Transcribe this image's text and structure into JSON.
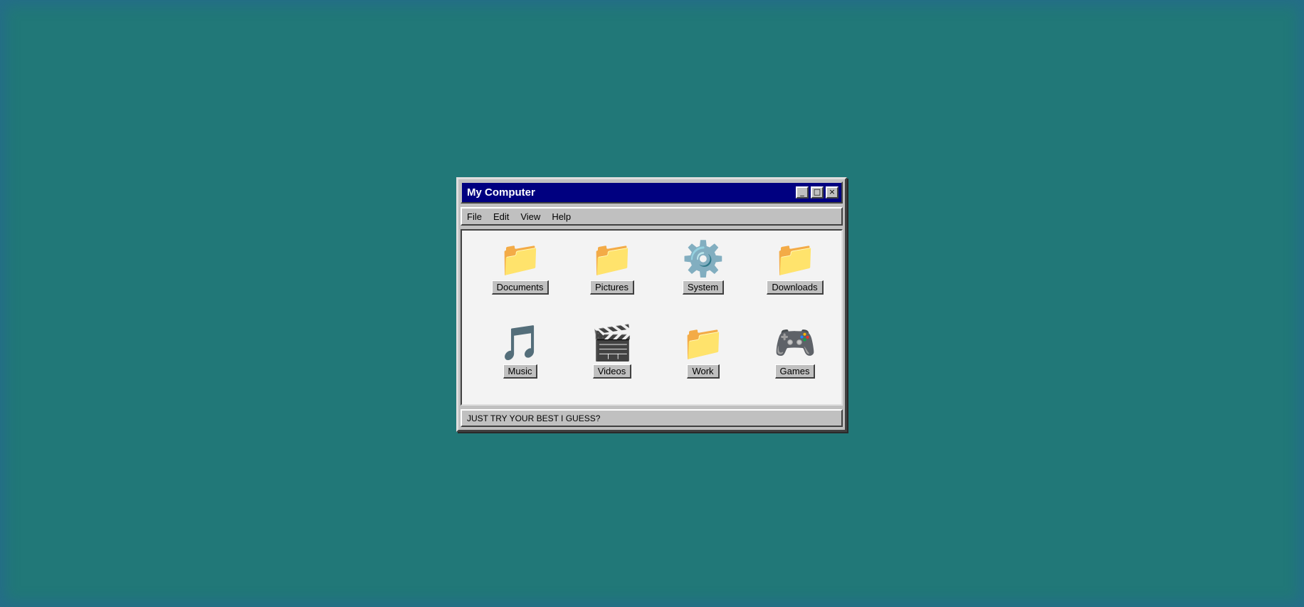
{
  "window": {
    "title": "My Computer",
    "controls": {
      "minimize": "_",
      "maximize": "□",
      "close": "×"
    }
  },
  "menu": {
    "items": [
      "File",
      "Edit",
      "View",
      "Help"
    ]
  },
  "icons": [
    {
      "label": "Documents",
      "glyph": "📁",
      "icon": "folder-icon"
    },
    {
      "label": "Pictures",
      "glyph": "📁",
      "icon": "folder-icon"
    },
    {
      "label": "System",
      "glyph": "⚙️",
      "icon": "gear-icon"
    },
    {
      "label": "Downloads",
      "glyph": "📁",
      "icon": "folder-icon"
    },
    {
      "label": "Music",
      "glyph": "🎵",
      "icon": "music-note-icon"
    },
    {
      "label": "Videos",
      "glyph": "🎬",
      "icon": "clapperboard-icon"
    },
    {
      "label": "Work",
      "glyph": "📁",
      "icon": "folder-icon"
    },
    {
      "label": "Games",
      "glyph": "🎮",
      "icon": "gamepad-icon"
    }
  ],
  "status": {
    "text": "JUST TRY YOUR BEST I GUESS?"
  },
  "colors": {
    "desktop": "#217878",
    "title_bar": "#000080",
    "chrome": "#c0c0c0",
    "content_bg": "#f3f3f3"
  }
}
